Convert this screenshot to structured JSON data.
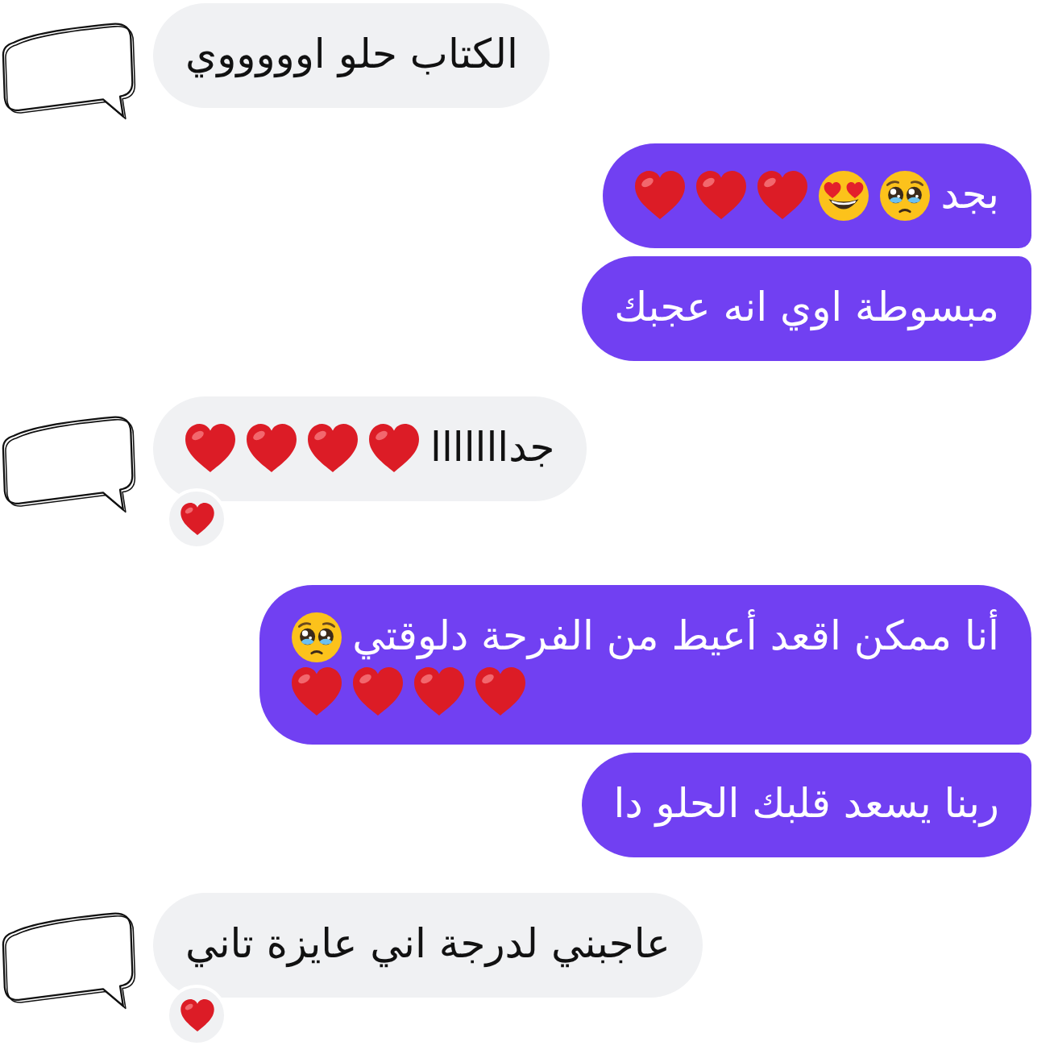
{
  "messages": [
    {
      "kind": "received",
      "paragraphs": [
        {
          "text": "الكتاب حلو اوووووي"
        }
      ]
    },
    {
      "kind": "sent",
      "paragraphs": [
        {
          "text": "بجد",
          "emojis": [
            {
              "kind": "pleading_face"
            },
            {
              "kind": "heart_eyes"
            },
            {
              "kind": "heart"
            },
            {
              "kind": "heart"
            },
            {
              "kind": "heart"
            }
          ]
        }
      ]
    },
    {
      "kind": "sent",
      "paragraphs": [
        {
          "text": "مبسوطة اوي انه عجبك"
        }
      ]
    },
    {
      "kind": "received",
      "paragraphs": [
        {
          "text": "جدااااااا",
          "emojis": [
            {
              "kind": "heart"
            },
            {
              "kind": "heart"
            },
            {
              "kind": "heart"
            },
            {
              "kind": "heart"
            }
          ]
        }
      ],
      "reaction": {
        "kind": "heart"
      }
    },
    {
      "kind": "sent",
      "paragraphs": [
        {
          "text": "أنا ممكن اقعد أعيط من الفرحة دلوقتي",
          "emojis": [
            {
              "kind": "pleading_face"
            }
          ]
        },
        {
          "emojis": [
            {
              "kind": "heart"
            },
            {
              "kind": "heart"
            },
            {
              "kind": "heart"
            },
            {
              "kind": "heart"
            }
          ]
        }
      ]
    },
    {
      "kind": "sent",
      "paragraphs": [
        {
          "text": "ربنا يسعد قلبك الحلو دا"
        }
      ]
    },
    {
      "kind": "received",
      "paragraphs": [
        {
          "text": "عاجبني لدرجة اني عايزة تاني"
        }
      ],
      "reaction": {
        "kind": "heart"
      }
    }
  ]
}
